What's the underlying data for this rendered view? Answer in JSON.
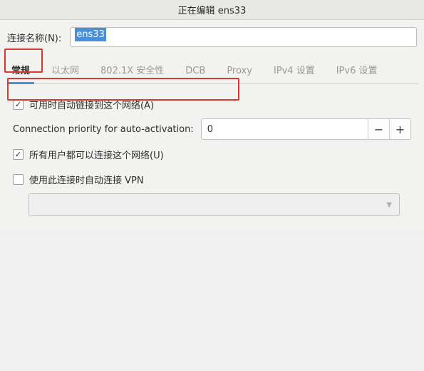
{
  "window": {
    "title": "正在编辑 ens33"
  },
  "form": {
    "name_label": "连接名称(N):",
    "name_value": "ens33"
  },
  "tabs": [
    {
      "label": "常规",
      "active": true
    },
    {
      "label": "以太网",
      "active": false
    },
    {
      "label": "802.1X 安全性",
      "active": false
    },
    {
      "label": "DCB",
      "active": false
    },
    {
      "label": "Proxy",
      "active": false
    },
    {
      "label": "IPv4 设置",
      "active": false
    },
    {
      "label": "IPv6 设置",
      "active": false
    }
  ],
  "general": {
    "auto_connect_label": "可用时自动链接到这个网络(A)",
    "auto_connect_checked": true,
    "priority_label": "Connection priority for auto-activation:",
    "priority_value": "0",
    "minus": "−",
    "plus": "+",
    "all_users_label": "所有用户都可以连接这个网络(U)",
    "all_users_checked": true,
    "vpn_label": "使用此连接时自动连接 VPN",
    "vpn_checked": false
  }
}
